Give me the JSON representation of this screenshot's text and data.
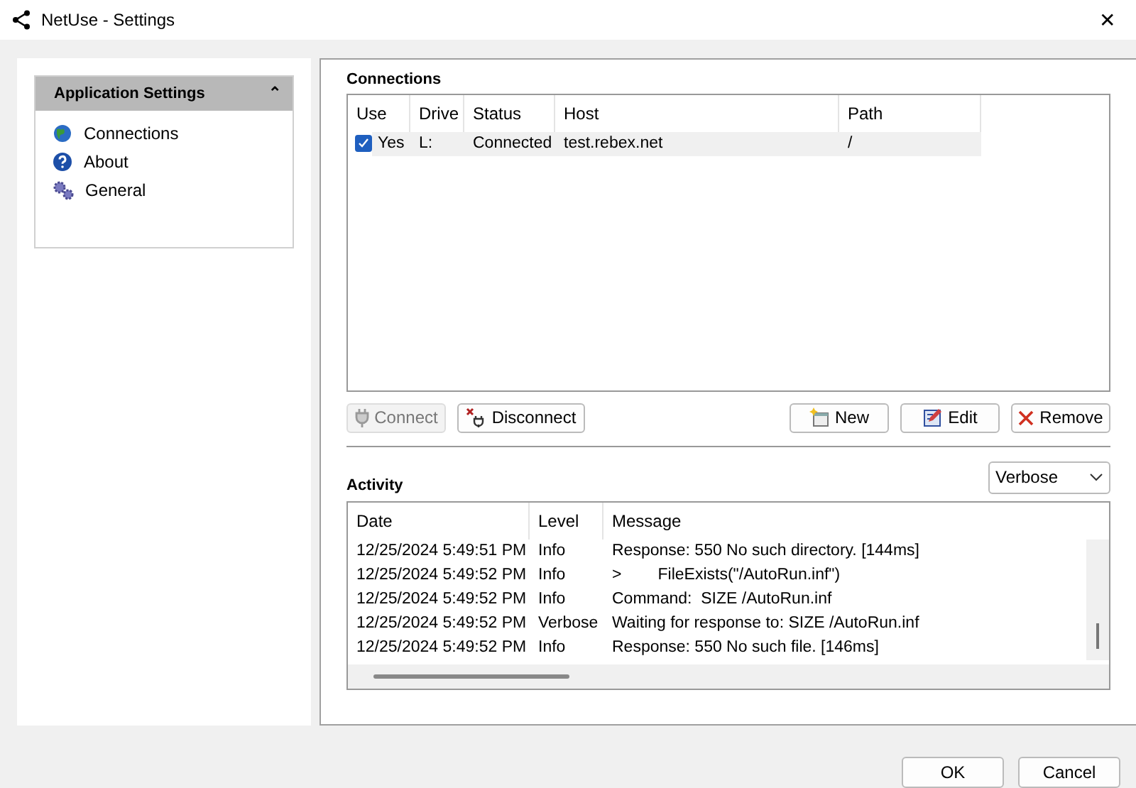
{
  "window": {
    "title": "NetUse - Settings",
    "close": "✕"
  },
  "sidebar": {
    "title": "Application Settings",
    "collapse": "⌃",
    "items": [
      {
        "label": "Connections",
        "kind": "globe"
      },
      {
        "label": "About",
        "kind": "help"
      },
      {
        "label": "General",
        "kind": "gears"
      }
    ]
  },
  "connections": {
    "title": "Connections",
    "columns": [
      "Use",
      "Drive",
      "Status",
      "Host",
      "Path"
    ],
    "rows": [
      {
        "checked": true,
        "use": "Yes",
        "drive": "L:",
        "status": "Connected",
        "host": "test.rebex.net",
        "path": "/"
      }
    ],
    "buttons": [
      {
        "label": "Connect",
        "kind": "plug",
        "disabled": true
      },
      {
        "label": "Disconnect",
        "kind": "unplug",
        "disabled": false
      },
      {
        "label": "New",
        "kind": "new",
        "disabled": false
      },
      {
        "label": "Edit",
        "kind": "edit",
        "disabled": false
      },
      {
        "label": "Remove",
        "kind": "remove",
        "disabled": false
      }
    ]
  },
  "activity": {
    "title": "Activity",
    "level_filter": "Verbose",
    "columns": [
      "Date",
      "Level",
      "Message"
    ],
    "rows": [
      {
        "date": "12/25/2024 5:49:51 PM",
        "level": "Info",
        "message": "Response: 550 No such directory. [144ms]"
      },
      {
        "date": "12/25/2024 5:49:52 PM",
        "level": "Info",
        "message": ">        FileExists(\"/AutoRun.inf\")"
      },
      {
        "date": "12/25/2024 5:49:52 PM",
        "level": "Info",
        "message": "Command:  SIZE /AutoRun.inf"
      },
      {
        "date": "12/25/2024 5:49:52 PM",
        "level": "Verbose",
        "message": "Waiting for response to: SIZE /AutoRun.inf"
      },
      {
        "date": "12/25/2024 5:49:52 PM",
        "level": "Info",
        "message": "Response: 550 No such file. [146ms]"
      }
    ]
  },
  "footer": {
    "buttons": [
      "OK",
      "Cancel"
    ]
  }
}
